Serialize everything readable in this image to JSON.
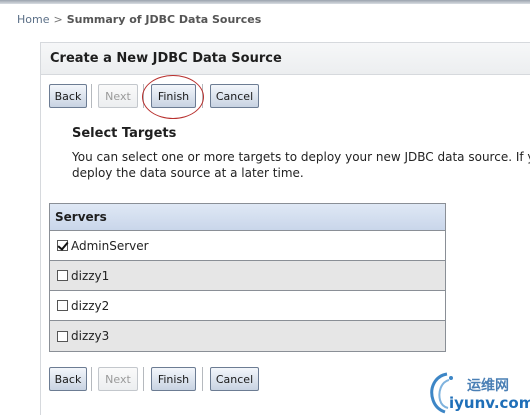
{
  "breadcrumb": {
    "home": "Home",
    "separator": ">",
    "current": "Summary of JDBC Data Sources"
  },
  "panel": {
    "title": "Create a New JDBC Data Source"
  },
  "buttons": {
    "back": "Back",
    "next": "Next",
    "finish": "Finish",
    "cancel": "Cancel"
  },
  "targets": {
    "title": "Select Targets",
    "description_line1": "You can select one or more targets to deploy your new JDBC data source. If you",
    "description_line2": "deploy the data source at a later time."
  },
  "servers": {
    "header": "Servers",
    "rows": [
      {
        "name": "AdminServer",
        "checked": true
      },
      {
        "name": "dizzy1",
        "checked": false
      },
      {
        "name": "dizzy2",
        "checked": false
      },
      {
        "name": "dizzy3",
        "checked": false
      }
    ]
  },
  "watermark": {
    "chinese": "运维网",
    "url": "iyunv.com"
  },
  "colors": {
    "accent_ring": "#b8312f",
    "button_border": "#6c7c93",
    "table_header": "#c9d6ea"
  }
}
